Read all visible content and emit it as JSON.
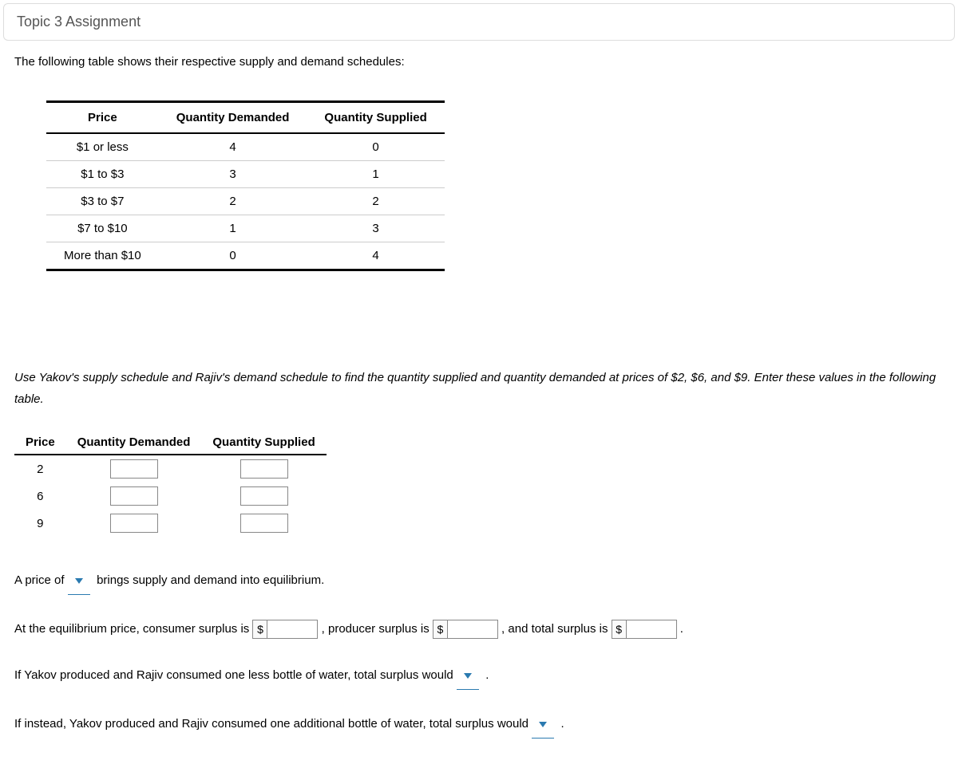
{
  "header": {
    "title": "Topic 3 Assignment"
  },
  "intro": "The following table shows their respective supply and demand schedules:",
  "table1": {
    "headers": [
      "Price",
      "Quantity Demanded",
      "Quantity Supplied"
    ],
    "rows": [
      {
        "price": "$1 or less",
        "qd": "4",
        "qs": "0"
      },
      {
        "price": "$1 to $3",
        "qd": "3",
        "qs": "1"
      },
      {
        "price": "$3 to $7",
        "qd": "2",
        "qs": "2"
      },
      {
        "price": "$7 to $10",
        "qd": "1",
        "qs": "3"
      },
      {
        "price": "More than $10",
        "qd": "0",
        "qs": "4"
      }
    ]
  },
  "instructions": "Use Yakov's supply schedule and Rajiv's demand schedule to find the quantity supplied and quantity demanded at prices of $2, $6, and $9. Enter these values in the following table.",
  "table2": {
    "headers": [
      "Price",
      "Quantity Demanded",
      "Quantity Supplied"
    ],
    "rows": [
      {
        "price": "2"
      },
      {
        "price": "6"
      },
      {
        "price": "9"
      }
    ]
  },
  "q1": {
    "pre": "A price of",
    "post": "brings supply and demand into equilibrium."
  },
  "q2": {
    "t1": "At the equilibrium price, consumer surplus is",
    "t2": ", producer surplus is",
    "t3": ", and total surplus is",
    "t4": ".",
    "dollar": "$"
  },
  "q3": {
    "pre": "If Yakov produced and Rajiv consumed one less bottle of water, total surplus would",
    "post": "."
  },
  "q4": {
    "pre": "If instead, Yakov produced and Rajiv consumed one additional bottle of water, total surplus would",
    "post": "."
  }
}
